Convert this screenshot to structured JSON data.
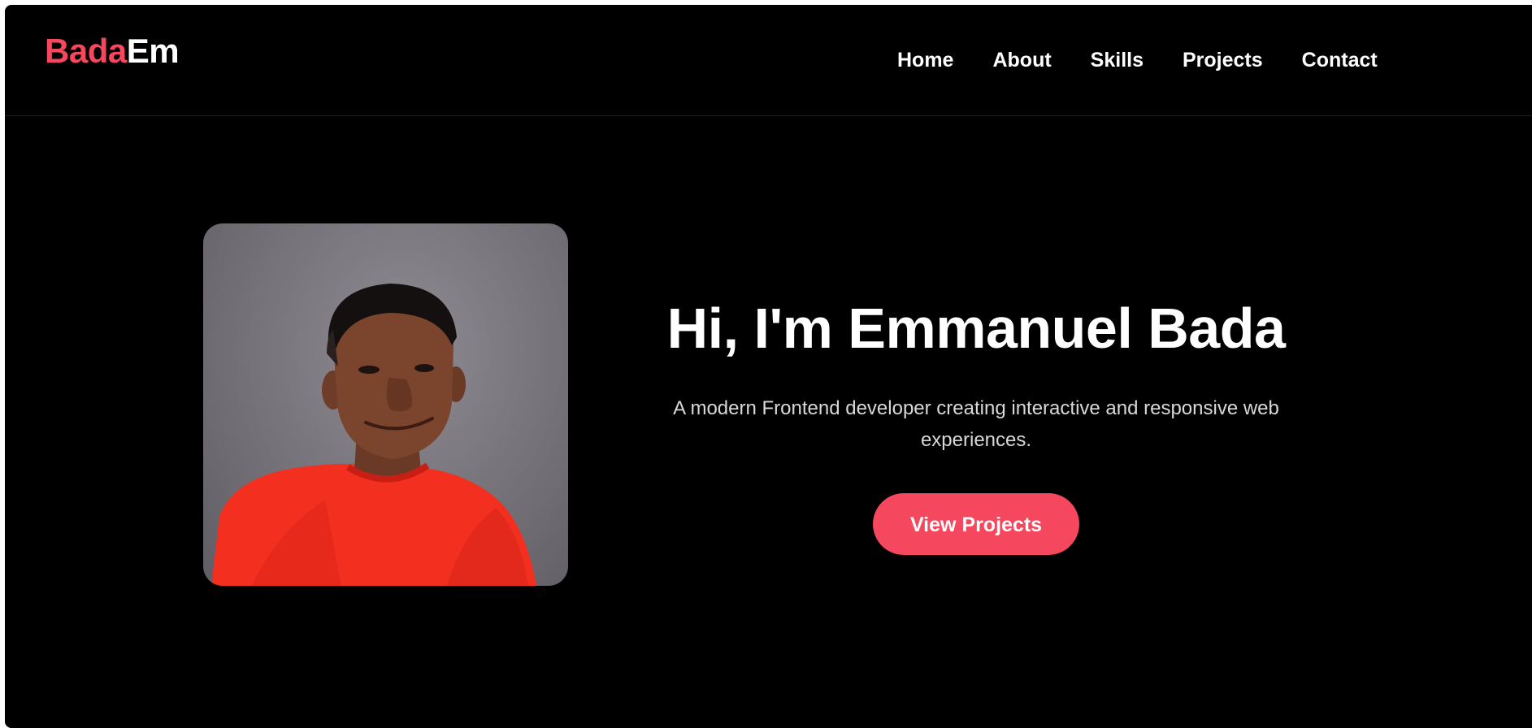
{
  "theme": {
    "accent": "#f5475e",
    "background": "#000000",
    "text": "#ffffff",
    "muted_text": "#d8d8d8"
  },
  "header": {
    "logo_part1": "Bada",
    "logo_part2": "Em",
    "nav": [
      {
        "label": "Home"
      },
      {
        "label": "About"
      },
      {
        "label": "Skills"
      },
      {
        "label": "Projects"
      },
      {
        "label": "Contact"
      }
    ]
  },
  "hero": {
    "photo_icon": "portrait-photo",
    "title": "Hi, I'm Emmanuel Bada",
    "subtitle": "A modern Frontend developer creating interactive and responsive web experiences.",
    "cta_label": "View Projects"
  }
}
